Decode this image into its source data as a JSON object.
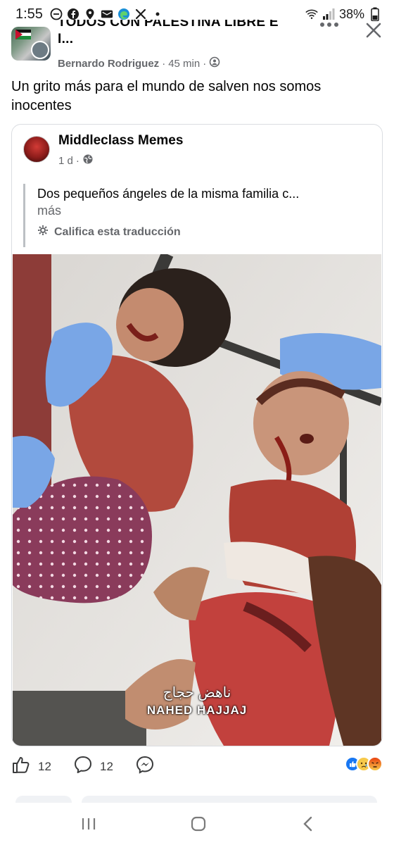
{
  "status_bar": {
    "time": "1:55",
    "battery": "38%"
  },
  "header": {
    "group_title_line1": "TODOS CON PALESTINA LIBRE E",
    "group_title_line2": "I...",
    "author": "Bernardo Rodriguez",
    "separator": "·",
    "time_ago": "45 min",
    "separator2": "·"
  },
  "post": {
    "caption": "Un grito más para el mundo de salven nos somos inocentes"
  },
  "shared_post": {
    "page_name": "Middleclass Memes",
    "time_ago": "1 d",
    "separator": "·",
    "text": "Dos pequeños ángeles de la misma familia c...",
    "more_label": "más",
    "translate_label": "Califica esta traducción",
    "watermark_arabic": "ناهض حجاج",
    "watermark_latin": "NAHED HAJJAJ"
  },
  "actions": {
    "likes_count": "12",
    "comments_count": "12"
  },
  "colors": {
    "primary_text": "#050505",
    "secondary_text": "#65676b",
    "like_blue": "#1877f2",
    "angry_red": "#e9710f",
    "divider": "#dadde1"
  },
  "icons": {
    "status": [
      "minus-circle-icon",
      "facebook-icon",
      "location-icon",
      "email-icon",
      "edge-icon",
      "tools-icon",
      "dot-icon"
    ],
    "status_right": [
      "wifi-icon",
      "signal-icon",
      "battery-icon"
    ],
    "header": [
      "more-icon",
      "close-icon"
    ],
    "post_meta": [
      "public-icon"
    ],
    "actions": [
      "like-icon",
      "comment-icon",
      "messenger-icon"
    ],
    "reactions": [
      "like-reaction-icon",
      "sad-reaction-icon",
      "angry-reaction-icon"
    ],
    "nav": [
      "recents-icon",
      "home-icon",
      "back-icon"
    ]
  }
}
